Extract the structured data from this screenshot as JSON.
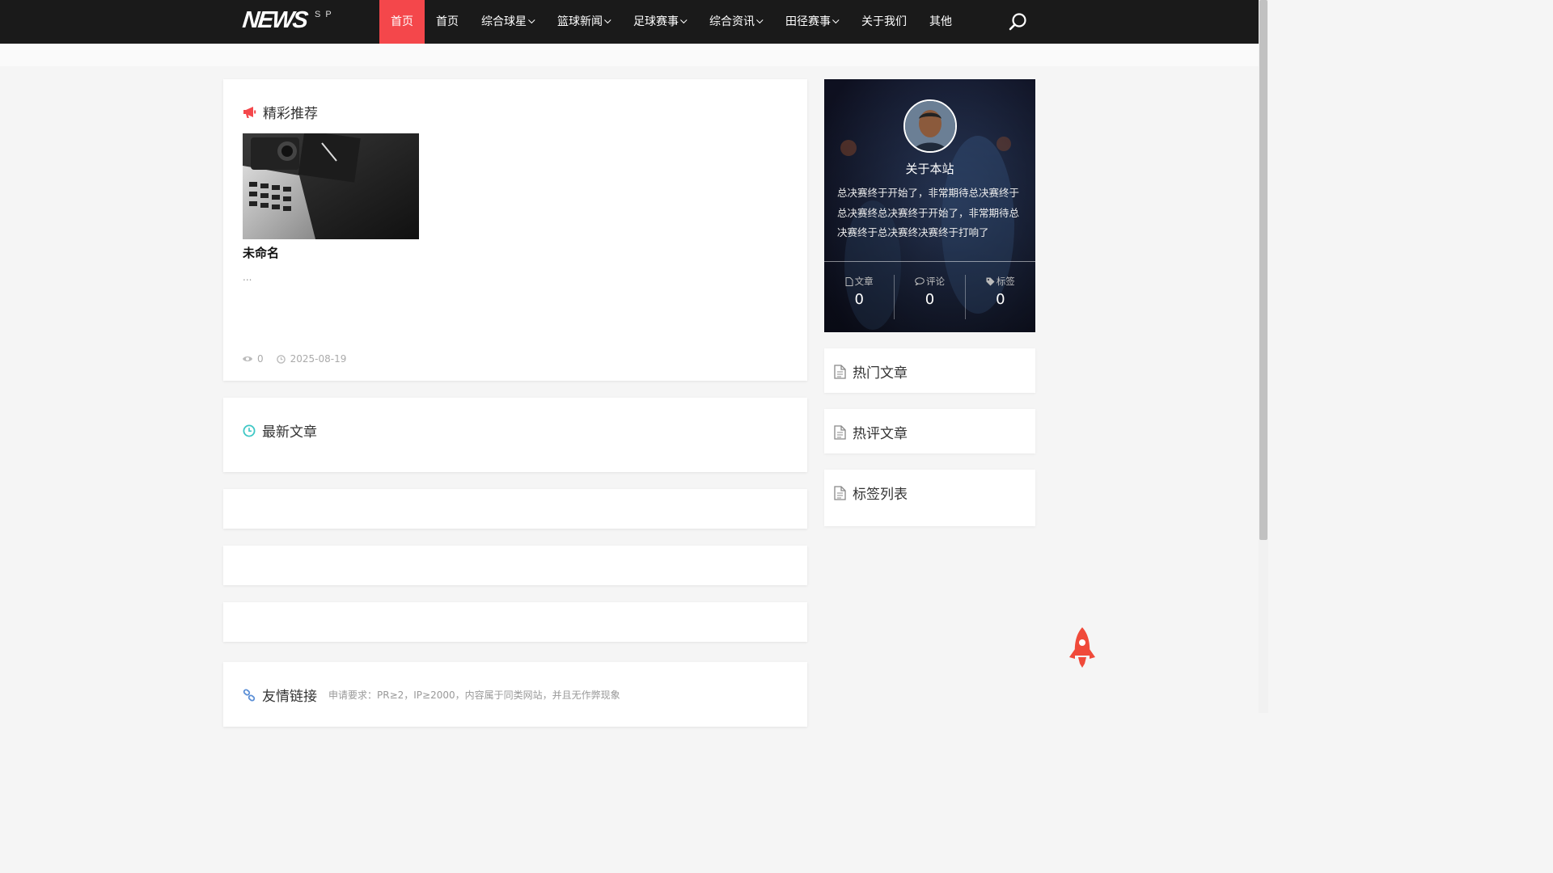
{
  "nav": {
    "logo_main": "NEWS",
    "logo_sub": "SP",
    "items": [
      {
        "label": "首页",
        "active": true,
        "dropdown": false
      },
      {
        "label": "首页",
        "active": false,
        "dropdown": false
      },
      {
        "label": "综合球星",
        "active": false,
        "dropdown": true
      },
      {
        "label": "篮球新闻",
        "active": false,
        "dropdown": true
      },
      {
        "label": "足球赛事",
        "active": false,
        "dropdown": true
      },
      {
        "label": "综合资讯",
        "active": false,
        "dropdown": true
      },
      {
        "label": "田径赛事",
        "active": false,
        "dropdown": true
      },
      {
        "label": "关于我们",
        "active": false,
        "dropdown": false
      },
      {
        "label": "其他",
        "active": false,
        "dropdown": false
      }
    ],
    "search_icon": "search-icon",
    "active_color": "#f4474b",
    "bg_color": "#1a1a1a"
  },
  "featured": {
    "title": "精彩推荐",
    "icon": "megaphone-icon",
    "post": {
      "title": "未命名",
      "excerpt": "...",
      "views": "0",
      "date": "2025-08-19"
    }
  },
  "latest": {
    "title": "最新文章",
    "icon": "clock-icon"
  },
  "links": {
    "title": "友情链接",
    "icon": "link-icon",
    "note": "申请要求：PR≥2，IP≥2000，内容属于同类网站，并且无作弊现象"
  },
  "about": {
    "title": "关于本站",
    "description": "总决赛终于开始了，非常期待总决赛终于总决赛终总决赛终于开始了，非常期待总决赛终于总决赛终决赛终于打响了",
    "stats": [
      {
        "label": "文章",
        "value": "0",
        "icon": "document-icon"
      },
      {
        "label": "评论",
        "value": "0",
        "icon": "comment-icon"
      },
      {
        "label": "标签",
        "value": "0",
        "icon": "tag-icon"
      }
    ]
  },
  "sidebar": {
    "hot_articles": "热门文章",
    "hot_comments": "热评文章",
    "tag_list": "标签列表"
  },
  "back_to_top_icon": "rocket-icon"
}
